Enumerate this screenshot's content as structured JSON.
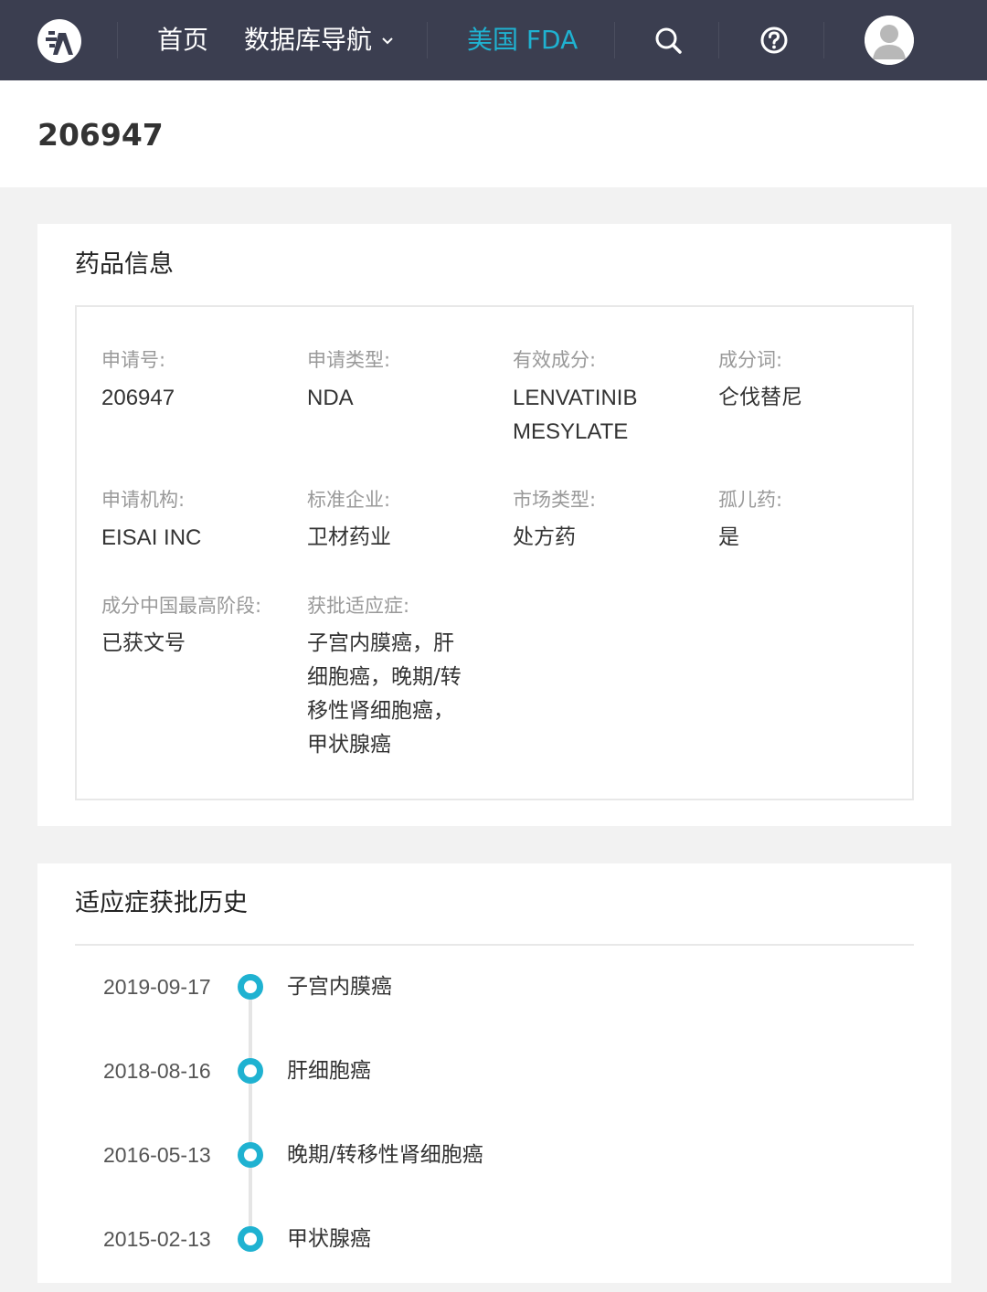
{
  "header": {
    "nav": [
      {
        "label": "首页"
      },
      {
        "label": "数据库导航"
      },
      {
        "label": "美国 FDA"
      }
    ],
    "icons": [
      "logo-icon",
      "chevron-down-icon",
      "search-icon",
      "help-icon",
      "user-avatar-icon"
    ],
    "accent_color": "#1fb2d1",
    "bar_color": "#3b3e50"
  },
  "page": {
    "title": "206947"
  },
  "drug_info": {
    "section_title": "药品信息",
    "fields": [
      {
        "label": "申请号:",
        "value": "206947"
      },
      {
        "label": "申请类型:",
        "value": "NDA"
      },
      {
        "label": "有效成分:",
        "value": "LENVATINIB MESYLATE"
      },
      {
        "label": "成分词:",
        "value": "仑伐替尼"
      },
      {
        "label": "申请机构:",
        "value": "EISAI INC"
      },
      {
        "label": "标准企业:",
        "value": "卫材药业"
      },
      {
        "label": "市场类型:",
        "value": "处方药"
      },
      {
        "label": "孤儿药:",
        "value": "是"
      },
      {
        "label": "成分中国最高阶段:",
        "value": "已获文号"
      },
      {
        "label": "获批适应症:",
        "value": "子宫内膜癌，肝细胞癌，晚期/转移性肾细胞癌，甲状腺癌"
      }
    ]
  },
  "history": {
    "section_title": "适应症获批历史",
    "events": [
      {
        "date": "2019-09-17",
        "indication": "子宫内膜癌"
      },
      {
        "date": "2018-08-16",
        "indication": "肝细胞癌"
      },
      {
        "date": "2016-05-13",
        "indication": "晚期/转移性肾细胞癌"
      },
      {
        "date": "2015-02-13",
        "indication": "甲状腺癌"
      }
    ]
  }
}
